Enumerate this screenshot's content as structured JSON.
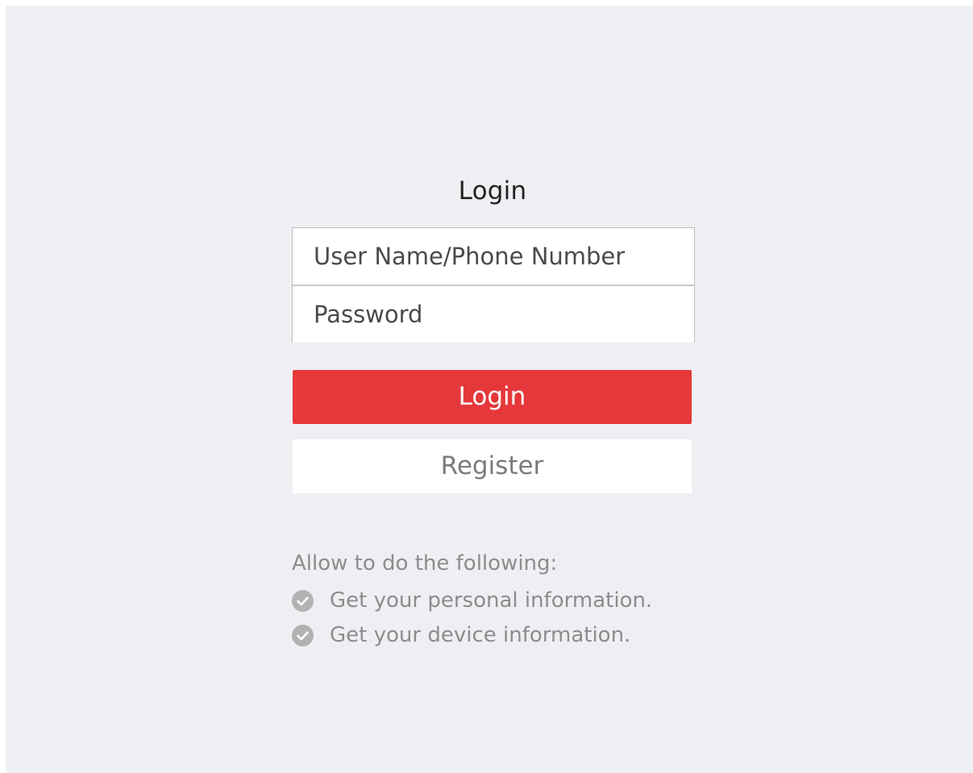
{
  "login": {
    "title": "Login",
    "username_placeholder": "User Name/Phone Number",
    "password_placeholder": "Password",
    "login_button": "Login",
    "register_button": "Register"
  },
  "permissions": {
    "heading": "Allow to do the following:",
    "items": [
      "Get your personal information.",
      "Get your device information."
    ]
  },
  "icons": {
    "check": "check-circle-icon"
  },
  "colors": {
    "background": "#efeff3",
    "accent": "#e5383b",
    "muted_text": "#8c8c8c"
  }
}
